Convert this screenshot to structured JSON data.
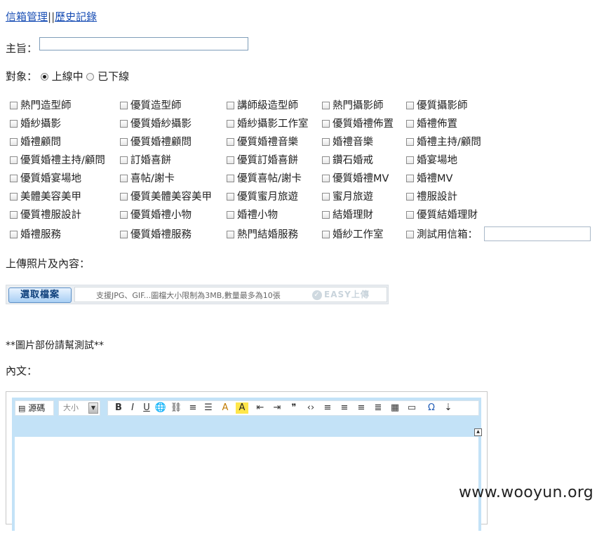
{
  "nav": {
    "link1": "信箱管理",
    "sep": "||",
    "link2": "歷史記錄"
  },
  "subject": {
    "label": "主旨：",
    "value": ""
  },
  "target": {
    "label": "對象：",
    "option_online": "上線中",
    "option_offline": "已下線",
    "selected": "上線中"
  },
  "categories": [
    [
      "熱門造型師",
      "優質造型師",
      "講師級造型師",
      "熱門攝影師",
      "優質攝影師"
    ],
    [
      "婚紗攝影",
      "優質婚紗攝影",
      "婚紗攝影工作室",
      "優質婚禮佈置",
      "婚禮佈置"
    ],
    [
      "婚禮顧問",
      "優質婚禮顧問",
      "優質婚禮音樂",
      "婚禮音樂",
      "婚禮主持/顧問"
    ],
    [
      "優質婚禮主持/顧問",
      "訂婚喜餅",
      "優質訂婚喜餅",
      "鑽石婚戒",
      "婚宴場地"
    ],
    [
      "優質婚宴場地",
      "喜帖/謝卡",
      "優質喜帖/謝卡",
      "優質婚禮MV",
      "婚禮MV"
    ],
    [
      "美體美容美甲",
      "優質美體美容美甲",
      "優質蜜月旅遊",
      "蜜月旅遊",
      "禮服設計"
    ],
    [
      "優質禮服設計",
      "優質婚禮小物",
      "婚禮小物",
      "結婚理財",
      "優質結婚理財"
    ],
    [
      "婚禮服務",
      "優質婚禮服務",
      "熱門結婚服務",
      "婚紗工作室",
      "測試用信箱："
    ]
  ],
  "upload": {
    "label": "上傳照片及內容：",
    "button": "選取檔案",
    "hint": "支援JPG、GIF...圖檔大小限制為3MB,數量最多為10張",
    "brand": "EASY上傳"
  },
  "note": "**圖片部份請幫測試**",
  "body_label": "內文：",
  "editor": {
    "source_label": "源碼",
    "size_label": "大小",
    "tools": [
      "bold-icon",
      "italic-icon",
      "underline-icon",
      "link-icon",
      "unlink-icon",
      "ordered-list-icon",
      "unordered-list-icon",
      "font-color-icon",
      "highlight-icon",
      "outdent-icon",
      "indent-icon",
      "blockquote-icon",
      "code-icon",
      "align-left-icon",
      "align-center-icon",
      "align-right-icon",
      "align-justify-icon",
      "table-icon",
      "horizontal-rule-icon",
      "special-char-icon",
      "page-break-icon"
    ]
  },
  "watermark": "www.wooyun.org"
}
